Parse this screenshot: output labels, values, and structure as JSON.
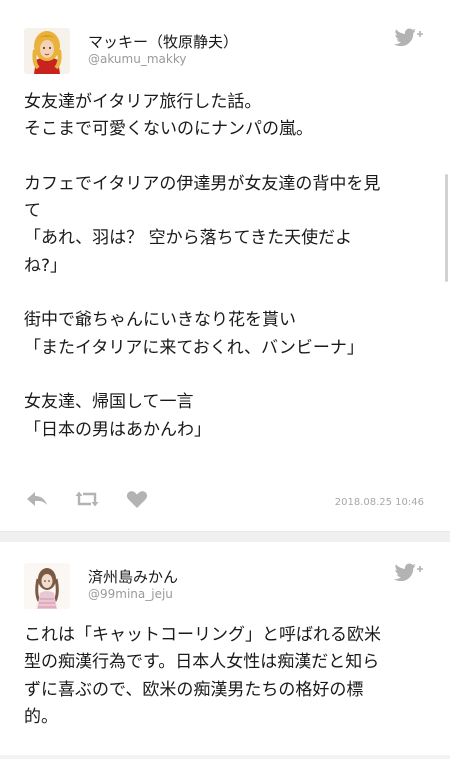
{
  "tweets": [
    {
      "display_name": "マッキー（牧原静夫）",
      "handle": "@akumu_makky",
      "lines": [
        "女友達がイタリア旅行した話。",
        "そこまで可愛くないのにナンパの嵐。",
        "",
        "カフェでイタリアの伊達男が女友達の背中を見",
        "て",
        "「あれ、羽は？ 空から落ちてきた天使だよ",
        "ね?」",
        "",
        "街中で爺ちゃんにいきなり花を貰い",
        "「またイタリアに来ておくれ、バンビーナ」",
        "",
        "女友達、帰国して一言",
        "「日本の男はあかんわ」"
      ],
      "timestamp": "2018.08.25 10:46",
      "icons": [
        "twitter-bird-icon",
        "reply-icon",
        "retweet-icon",
        "like-icon"
      ]
    },
    {
      "display_name": "済州島みかん",
      "handle": "@99mina_jeju",
      "lines": [
        "これは「キャットコーリング」と呼ばれる欧米",
        "型の痴漢行為です。日本人女性は痴漢だと知ら",
        "ずに喜ぶので、欧米の痴漢男たちの格好の標",
        "的。"
      ],
      "icons": [
        "twitter-bird-icon"
      ]
    }
  ],
  "colors": {
    "icon_gray": "#b3b3b3",
    "avatar1_hair": "#e9b23a",
    "avatar1_dress": "#c8231e"
  }
}
